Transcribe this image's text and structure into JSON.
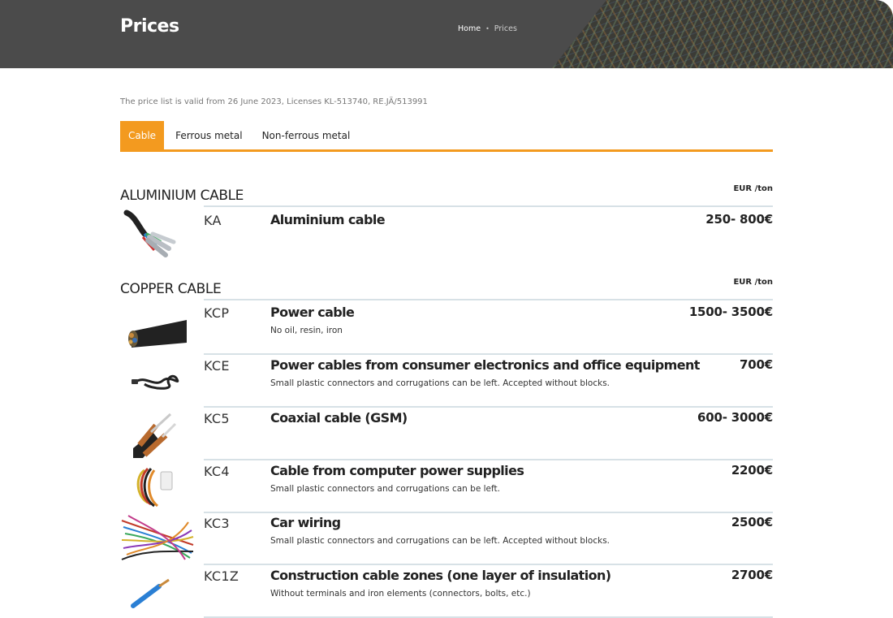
{
  "header": {
    "title": "Prices",
    "breadcrumb": {
      "home": "Home",
      "separator": "•",
      "current": "Prices"
    }
  },
  "validity_note": "The price list is valid from 26 June 2023, Licenses KL-513740, RE.JÄ/513991",
  "tabs": [
    {
      "label": "Cable",
      "active": true
    },
    {
      "label": "Ferrous metal",
      "active": false
    },
    {
      "label": "Non-ferrous metal",
      "active": false
    }
  ],
  "accent_color": "#f39a1f",
  "sections": [
    {
      "title": "ALUMINIUM CABLE",
      "unit": "EUR /ton",
      "items": [
        {
          "code": "KA",
          "name": "Aluminium cable",
          "note": "",
          "price": "250- 800€",
          "image": "aluminium-cable-image"
        }
      ]
    },
    {
      "title": "COPPER CABLE",
      "unit": "EUR /ton",
      "items": [
        {
          "code": "KCP",
          "name": "Power cable",
          "note": "No oil, resin, iron",
          "price": "1500- 3500€",
          "image": "power-cable-image"
        },
        {
          "code": "KCE",
          "name": "Power cables from consumer electronics and office equipment",
          "note": "Small plastic connectors and corrugations can be left. Accepted without blocks.",
          "price": "700€",
          "image": "electronics-cable-image"
        },
        {
          "code": "KC5",
          "name": "Coaxial cable (GSM)",
          "note": "",
          "price": "600- 3000€",
          "image": "coaxial-cable-image"
        },
        {
          "code": "KC4",
          "name": "Cable from computer power supplies",
          "note": "Small plastic connectors and corrugations can be left.",
          "price": "2200€",
          "image": "psu-cable-image"
        },
        {
          "code": "KC3",
          "name": "Car wiring",
          "note": "Small plastic connectors and corrugations can be left. Accepted without blocks.",
          "price": "2500€",
          "image": "car-wiring-image"
        },
        {
          "code": "KC1Z",
          "name": "Construction cable zones (one layer of insulation)",
          "note": "Without terminals and iron elements (connectors, bolts, etc.)",
          "price": "2700€",
          "image": "construction-cable-image"
        }
      ]
    }
  ]
}
